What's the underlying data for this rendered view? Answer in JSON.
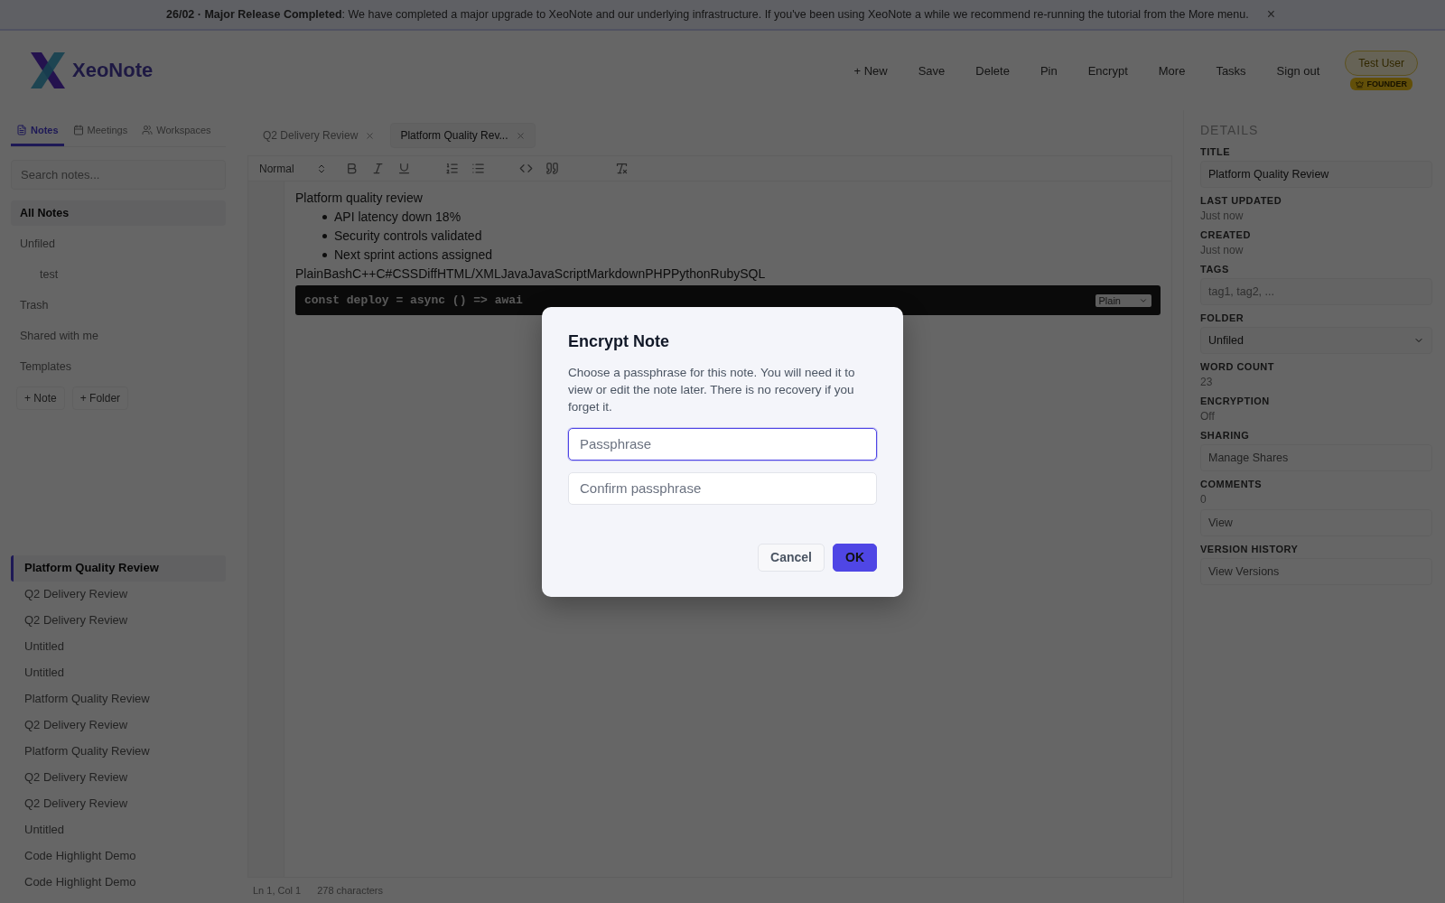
{
  "banner": {
    "text": "**26/02 · Major Release Completed**: We have completed a major upgrade to XeoNote and our underlying infrastructure. If you've been using XeoNote a while we recommend re-running the tutorial from the More menu.",
    "close": "×"
  },
  "header": {
    "brand": "XeoNote",
    "nav": [
      "+ New",
      "Save",
      "Delete",
      "Pin",
      "Encrypt",
      "More",
      "Tasks",
      "Sign out"
    ],
    "user": "Test User",
    "badge": "FOUNDER"
  },
  "sidebar": {
    "tabs": [
      {
        "label": "Notes",
        "kind": "notes",
        "selected": true
      },
      {
        "label": "Meetings",
        "kind": "meetings",
        "selected": false
      },
      {
        "label": "Workspaces",
        "kind": "workspaces",
        "selected": false
      }
    ],
    "search": {
      "placeholder": "Search notes..."
    },
    "folders": [
      {
        "label": "All Notes",
        "selected": true
      },
      {
        "label": "Unfiled",
        "selected": false,
        "children": [
          {
            "label": "test",
            "selected": false
          }
        ]
      },
      {
        "label": "Trash",
        "selected": false
      },
      {
        "label": "Shared with me",
        "selected": false
      },
      {
        "label": "Templates",
        "selected": false
      }
    ],
    "actions": [
      "+ Note",
      "+ Folder"
    ],
    "notes": [
      {
        "title": "Platform Quality Review",
        "selected": true
      },
      {
        "title": "Q2 Delivery Review",
        "selected": false
      },
      {
        "title": "Q2 Delivery Review",
        "selected": false
      },
      {
        "title": "Untitled",
        "selected": false
      },
      {
        "title": "Untitled",
        "selected": false
      },
      {
        "title": "Platform Quality Review",
        "selected": false
      },
      {
        "title": "Q2 Delivery Review",
        "selected": false
      },
      {
        "title": "Platform Quality Review",
        "selected": false
      },
      {
        "title": "Q2 Delivery Review",
        "selected": false
      },
      {
        "title": "Q2 Delivery Review",
        "selected": false
      },
      {
        "title": "Untitled",
        "selected": false
      },
      {
        "title": "Code Highlight Demo",
        "selected": false
      },
      {
        "title": "Code Highlight Demo",
        "selected": false
      }
    ]
  },
  "editor": {
    "tabs": [
      {
        "label": "Q2 Delivery Review",
        "selected": false
      },
      {
        "label": "Platform Quality Rev...",
        "selected": true
      }
    ],
    "format": "Normal",
    "lines": [
      {
        "kind": "paragraph",
        "text": "Platform quality review"
      },
      {
        "kind": "bullet",
        "text": "API latency down 18%"
      },
      {
        "kind": "bullet",
        "text": "Security controls validated"
      },
      {
        "kind": "bullet",
        "text": "Next sprint actions assigned"
      },
      {
        "kind": "paragraph",
        "text": "PlainBashC++C#CSSDiffHTML/XMLJavaJavaScriptMarkdownPHPPythonRubySQL"
      },
      {
        "kind": "code",
        "text": "const deploy = async () => awai",
        "language": "Plain"
      }
    ],
    "status": [
      "Ln 1, Col 1",
      "278 characters"
    ]
  },
  "details": {
    "heading": "DETAILS",
    "fields": [
      {
        "label": "TITLE",
        "kind": "input",
        "value": "Platform Quality Review"
      },
      {
        "label": "LAST UPDATED",
        "kind": "text",
        "value": "Just now"
      },
      {
        "label": "CREATED",
        "kind": "text",
        "value": "Just now"
      },
      {
        "label": "TAGS",
        "kind": "input",
        "placeholder": "tag1, tag2, ..."
      },
      {
        "label": "FOLDER",
        "kind": "select",
        "value": "Unfiled"
      },
      {
        "label": "WORD COUNT",
        "kind": "text",
        "value": "23"
      },
      {
        "label": "ENCRYPTION",
        "kind": "text",
        "value": "Off"
      },
      {
        "label": "SHARING",
        "kind": "button",
        "button": "Manage Shares"
      },
      {
        "label": "COMMENTS",
        "kind": "text_button",
        "value": "0",
        "button": "View"
      },
      {
        "label": "VERSION HISTORY",
        "kind": "button",
        "button": "View Versions"
      }
    ]
  },
  "dialog": {
    "title": "Encrypt Note",
    "message": "Choose a passphrase for this note. You will need it to view or edit the note later. There is no recovery if you forget it.",
    "fields": [
      {
        "placeholder": "Passphrase",
        "focused": true
      },
      {
        "placeholder": "Confirm passphrase",
        "focused": false
      }
    ],
    "buttons": [
      {
        "label": "Cancel",
        "kind": "secondary"
      },
      {
        "label": "OK",
        "kind": "primary"
      }
    ]
  }
}
